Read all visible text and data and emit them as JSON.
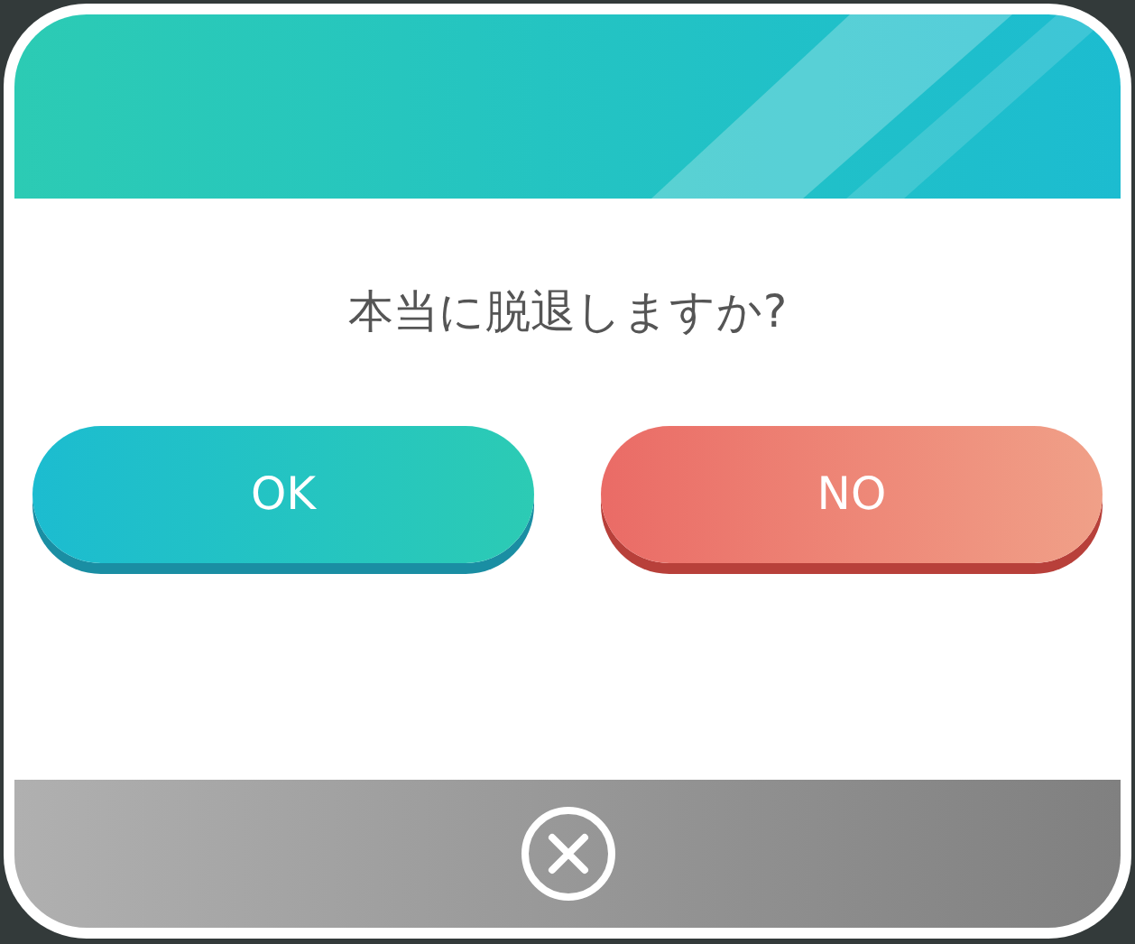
{
  "dialog": {
    "message": "本当に脱退しますか?",
    "buttons": [
      {
        "label": "OK",
        "kind": "confirm"
      },
      {
        "label": "NO",
        "kind": "cancel"
      }
    ]
  }
}
